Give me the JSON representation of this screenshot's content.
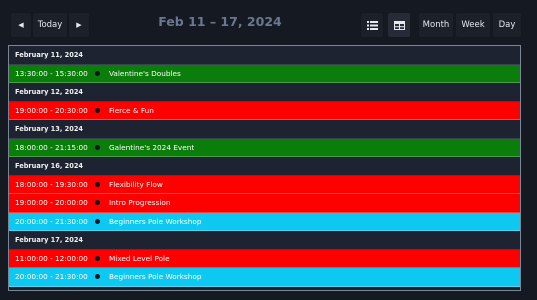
{
  "toolbar": {
    "prev_icon": "chevron-left-icon",
    "today_label": "Today",
    "next_icon": "chevron-right-icon",
    "title": "Feb 11 – 17, 2024",
    "list_view_icon": "list-icon",
    "grid_view_icon": "grid-icon",
    "month_label": "Month",
    "week_label": "Week",
    "day_label": "Day"
  },
  "colors": {
    "green": "#0b7d0b",
    "red": "#fd0000",
    "cyan": "#0dc8f0",
    "background": "#151a22",
    "day_header": "#1d2330"
  },
  "days": [
    {
      "label": "February 11, 2024",
      "events": [
        {
          "time": "13:30:00 - 15:30:00",
          "title": "Valentine's Doubles",
          "color": "green"
        }
      ]
    },
    {
      "label": "February 12, 2024",
      "events": [
        {
          "time": "19:00:00 - 20:30:00",
          "title": "Fierce & Fun",
          "color": "red"
        }
      ]
    },
    {
      "label": "February 13, 2024",
      "events": [
        {
          "time": "18:00:00 - 21:15:00",
          "title": "Galentine's 2024 Event",
          "color": "green"
        }
      ]
    },
    {
      "label": "February 16, 2024",
      "events": [
        {
          "time": "18:00:00 - 19:30:00",
          "title": "Flexibility Flow",
          "color": "red"
        },
        {
          "time": "19:00:00 - 20:00:00",
          "title": "Intro Progression",
          "color": "red"
        },
        {
          "time": "20:00:00 - 21:30:00",
          "title": "Beginners Pole Workshop",
          "color": "cyan"
        }
      ]
    },
    {
      "label": "February 17, 2024",
      "events": [
        {
          "time": "11:00:00 - 12:00:00",
          "title": "Mixed Level Pole",
          "color": "red"
        },
        {
          "time": "20:00:00 - 21:30:00",
          "title": "Beginners Pole Workshop",
          "color": "cyan"
        }
      ]
    }
  ]
}
